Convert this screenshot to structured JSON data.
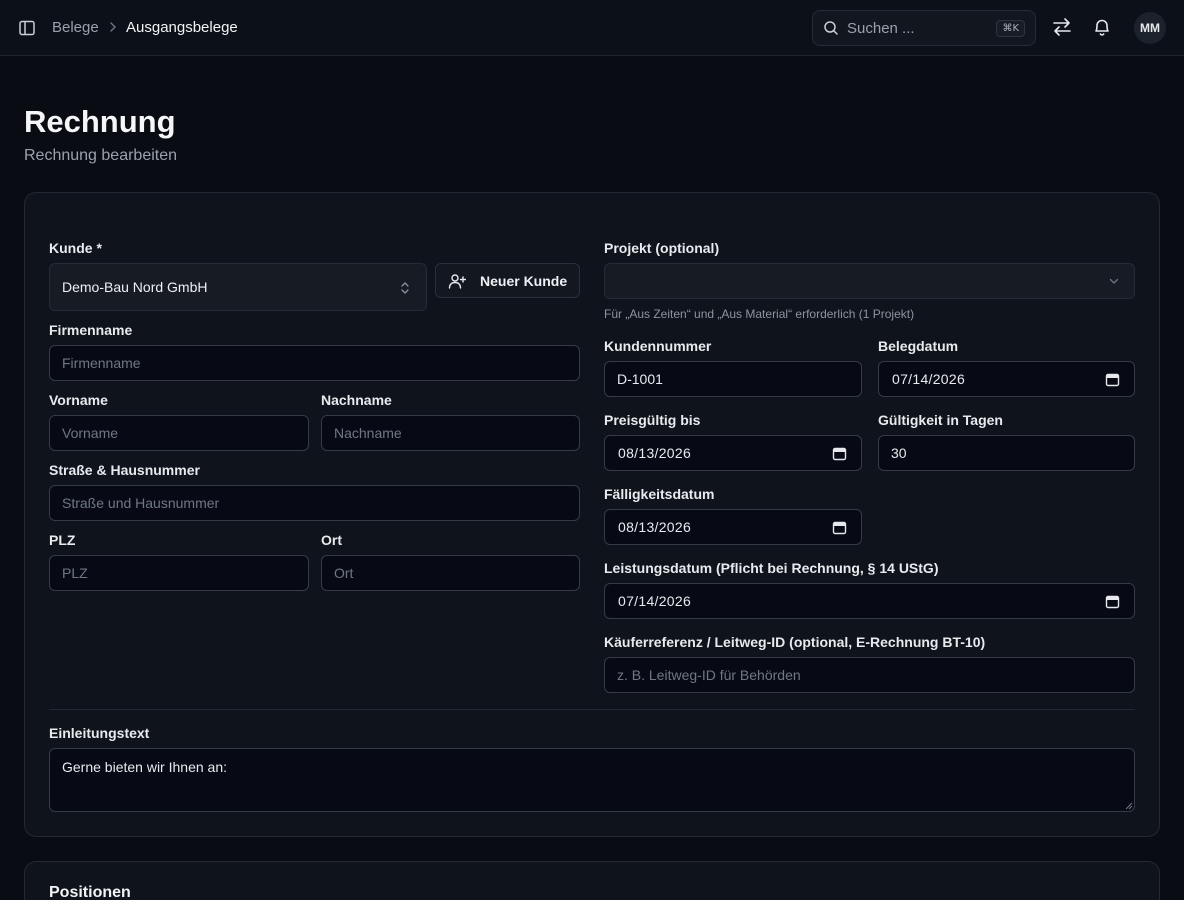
{
  "breadcrumb": {
    "parent": "Belege",
    "current": "Ausgangsbelege"
  },
  "search": {
    "placeholder": "Suchen ...",
    "shortcut": "⌘K"
  },
  "user": {
    "initials": "MM"
  },
  "page": {
    "title": "Rechnung",
    "subtitle": "Rechnung bearbeiten"
  },
  "customer": {
    "label": "Kunde *",
    "value": "Demo-Bau Nord GmbH",
    "new_button": "Neuer Kunde"
  },
  "fields": {
    "company": {
      "label": "Firmenname",
      "placeholder": "Firmenname"
    },
    "firstname": {
      "label": "Vorname",
      "placeholder": "Vorname"
    },
    "lastname": {
      "label": "Nachname",
      "placeholder": "Nachname"
    },
    "street": {
      "label": "Straße & Hausnummer",
      "placeholder": "Straße und Hausnummer"
    },
    "zip": {
      "label": "PLZ",
      "placeholder": "PLZ"
    },
    "city": {
      "label": "Ort",
      "placeholder": "Ort"
    }
  },
  "project": {
    "label": "Projekt (optional)",
    "hint": "Für „Aus Zeiten“ und „Aus Material“ erforderlich (1 Projekt)"
  },
  "customer_number": {
    "label": "Kundennummer",
    "value": "D-1001"
  },
  "document_date": {
    "label": "Belegdatum",
    "value": "07/14/2026"
  },
  "price_valid_until": {
    "label": "Preisgültig bis",
    "value": "08/13/2026"
  },
  "validity_days": {
    "label": "Gültigkeit in Tagen",
    "value": "30"
  },
  "due_date": {
    "label": "Fälligkeitsdatum",
    "value": "08/13/2026"
  },
  "service_date": {
    "label": "Leistungsdatum (Pflicht bei Rechnung, § 14 UStG)",
    "value": "07/14/2026"
  },
  "buyer_reference": {
    "label": "Käuferreferenz / Leitweg-ID (optional, E-Rechnung BT-10)",
    "placeholder": "z. B. Leitweg-ID für Behörden"
  },
  "intro": {
    "label": "Einleitungstext",
    "value": "Gerne bieten wir Ihnen an:"
  },
  "positions": {
    "title": "Positionen"
  },
  "icons": {
    "sidebar": "sidebar-toggle-icon",
    "search": "search-icon",
    "swap": "swap-icon",
    "bell": "bell-icon",
    "calendar": "calendar-icon",
    "user_plus": "user-plus-icon"
  }
}
